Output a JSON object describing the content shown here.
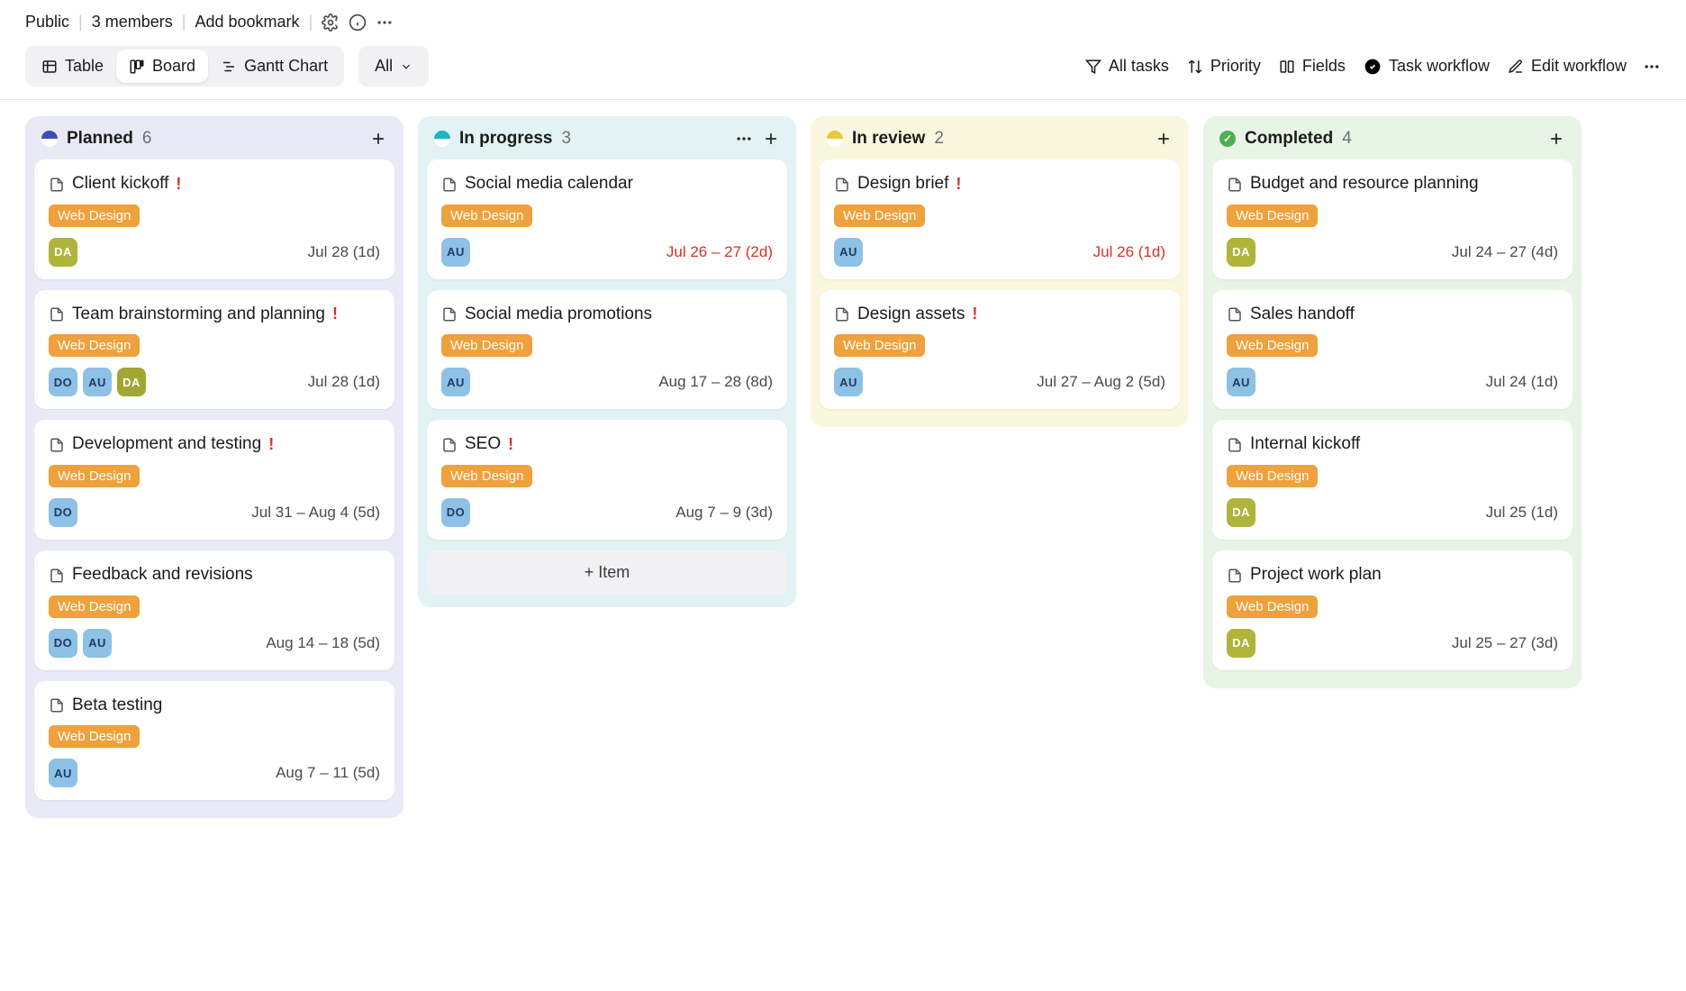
{
  "topbar": {
    "visibility": "Public",
    "members": "3 members",
    "add_bookmark": "Add bookmark"
  },
  "views": {
    "table": "Table",
    "board": "Board",
    "gantt": "Gantt Chart",
    "all": "All"
  },
  "controls": {
    "all_tasks": "All tasks",
    "priority": "Priority",
    "fields": "Fields",
    "task_workflow": "Task workflow",
    "edit_workflow": "Edit workflow"
  },
  "columns": [
    {
      "key": "planned",
      "label": "Planned",
      "count": "6",
      "cards": [
        {
          "title": "Client kickoff",
          "flag": true,
          "tag": "Web Design",
          "assignees": [
            {
              "initials": "DA",
              "cls": "av-olive"
            }
          ],
          "date": "Jul 28 (1d)",
          "overdue": false
        },
        {
          "title": "Team brainstorming and planning",
          "flag": true,
          "tag": "Web Design",
          "assignees": [
            {
              "initials": "DO",
              "cls": "av-blue"
            },
            {
              "initials": "AU",
              "cls": "av-blue"
            },
            {
              "initials": "DA",
              "cls": "av-darkolive"
            }
          ],
          "date": "Jul 28 (1d)",
          "overdue": false
        },
        {
          "title": "Development and testing",
          "flag": true,
          "tag": "Web Design",
          "assignees": [
            {
              "initials": "DO",
              "cls": "av-blue"
            }
          ],
          "date": "Jul 31 – Aug 4 (5d)",
          "overdue": false
        },
        {
          "title": "Feedback and revisions",
          "flag": false,
          "tag": "Web Design",
          "assignees": [
            {
              "initials": "DO",
              "cls": "av-blue"
            },
            {
              "initials": "AU",
              "cls": "av-blue"
            }
          ],
          "date": "Aug 14 – 18 (5d)",
          "overdue": false
        },
        {
          "title": "Beta testing",
          "flag": false,
          "tag": "Web Design",
          "assignees": [
            {
              "initials": "AU",
              "cls": "av-blue"
            }
          ],
          "date": "Aug 7 – 11 (5d)",
          "overdue": false
        }
      ]
    },
    {
      "key": "progress",
      "label": "In progress",
      "count": "3",
      "show_menu": true,
      "show_add_item": true,
      "cards": [
        {
          "title": "Social media calendar",
          "flag": false,
          "tag": "Web Design",
          "assignees": [
            {
              "initials": "AU",
              "cls": "av-blue"
            }
          ],
          "date": "Jul 26 – 27 (2d)",
          "overdue": true
        },
        {
          "title": "Social media promotions",
          "flag": false,
          "tag": "Web Design",
          "assignees": [
            {
              "initials": "AU",
              "cls": "av-blue"
            }
          ],
          "date": "Aug 17 – 28 (8d)",
          "overdue": false
        },
        {
          "title": "SEO",
          "flag": true,
          "tag": "Web Design",
          "assignees": [
            {
              "initials": "DO",
              "cls": "av-blue"
            }
          ],
          "date": "Aug 7 – 9 (3d)",
          "overdue": false
        }
      ]
    },
    {
      "key": "review",
      "label": "In review",
      "count": "2",
      "cards": [
        {
          "title": "Design brief",
          "flag": true,
          "tag": "Web Design",
          "assignees": [
            {
              "initials": "AU",
              "cls": "av-blue"
            }
          ],
          "date": "Jul 26 (1d)",
          "overdue": true
        },
        {
          "title": "Design assets",
          "flag": true,
          "tag": "Web Design",
          "assignees": [
            {
              "initials": "AU",
              "cls": "av-blue"
            }
          ],
          "date": "Jul 27 – Aug 2 (5d)",
          "overdue": false
        }
      ]
    },
    {
      "key": "completed",
      "label": "Completed",
      "count": "4",
      "cards": [
        {
          "title": "Budget and resource planning",
          "flag": false,
          "tag": "Web Design",
          "assignees": [
            {
              "initials": "DA",
              "cls": "av-olive"
            }
          ],
          "date": "Jul 24 – 27 (4d)",
          "overdue": false
        },
        {
          "title": "Sales handoff",
          "flag": false,
          "tag": "Web Design",
          "assignees": [
            {
              "initials": "AU",
              "cls": "av-blue"
            }
          ],
          "date": "Jul 24 (1d)",
          "overdue": false
        },
        {
          "title": "Internal kickoff",
          "flag": false,
          "tag": "Web Design",
          "assignees": [
            {
              "initials": "DA",
              "cls": "av-olive"
            }
          ],
          "date": "Jul 25 (1d)",
          "overdue": false
        },
        {
          "title": "Project work plan",
          "flag": false,
          "tag": "Web Design",
          "assignees": [
            {
              "initials": "DA",
              "cls": "av-olive"
            }
          ],
          "date": "Jul 25 – 27 (3d)",
          "overdue": false
        }
      ]
    }
  ],
  "add_item_label": "+ Item"
}
